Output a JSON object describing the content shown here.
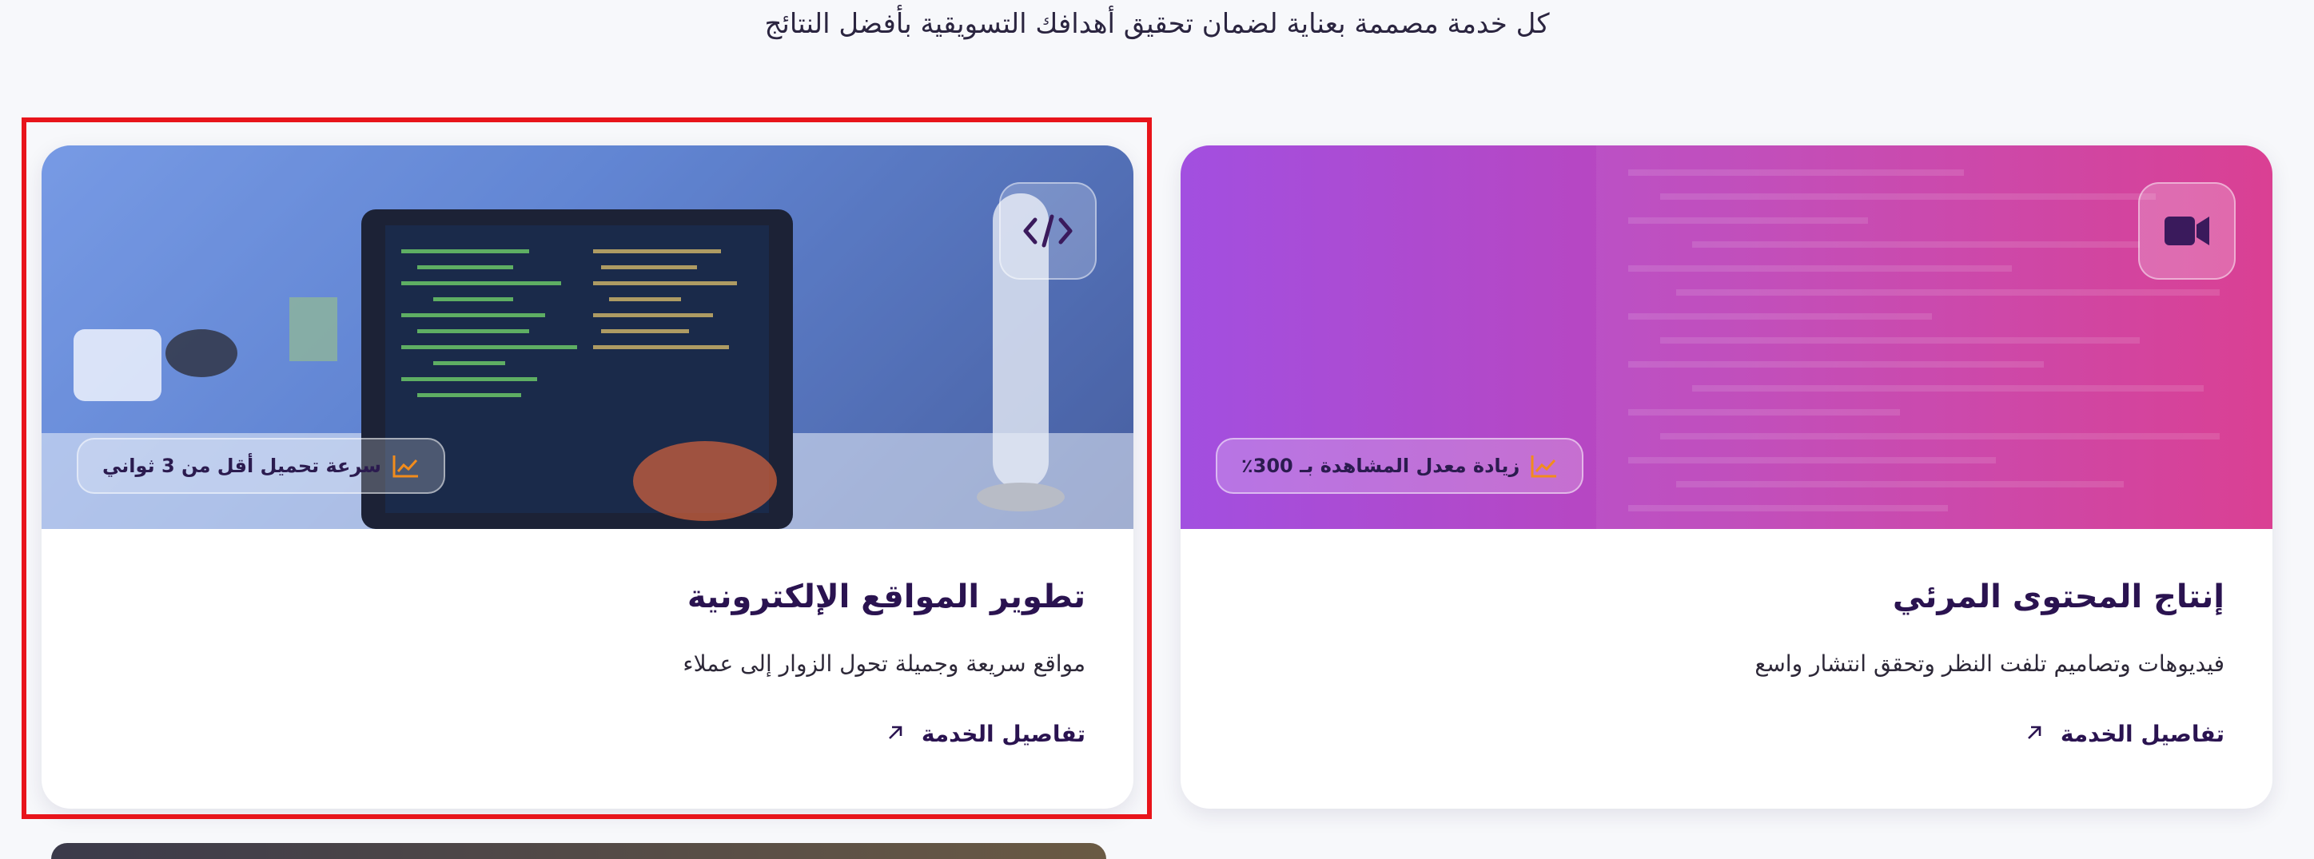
{
  "section": {
    "subtitle": "كل خدمة مصممة بعناية لضمان تحقيق أهدافك التسويقية بأفضل النتائج"
  },
  "cards": [
    {
      "id": "web-dev",
      "title": "تطوير المواقع الإلكترونية",
      "description": "مواقع سريعة وجميلة تحول الزوار إلى عملاء",
      "stat_badge": "سرعة تحميل أقل من 3 ثواني",
      "link_label": "تفاصيل الخدمة",
      "icon": "code-icon",
      "selected": true
    },
    {
      "id": "video-content",
      "title": "إنتاج المحتوى المرئي",
      "description": "فيديوهات وتصاميم تلفت النظر وتحقق انتشار واسع",
      "stat_badge": "زيادة معدل المشاهدة بـ 300٪",
      "link_label": "تفاصيل الخدمة",
      "icon": "video-camera-icon",
      "selected": false
    }
  ],
  "colors": {
    "title": "#2a1350",
    "stat_icon": "#f28c1c",
    "selection": "#e8141b",
    "video_gradient_start": "#a24fe0",
    "video_gradient_end": "#d8358d"
  }
}
